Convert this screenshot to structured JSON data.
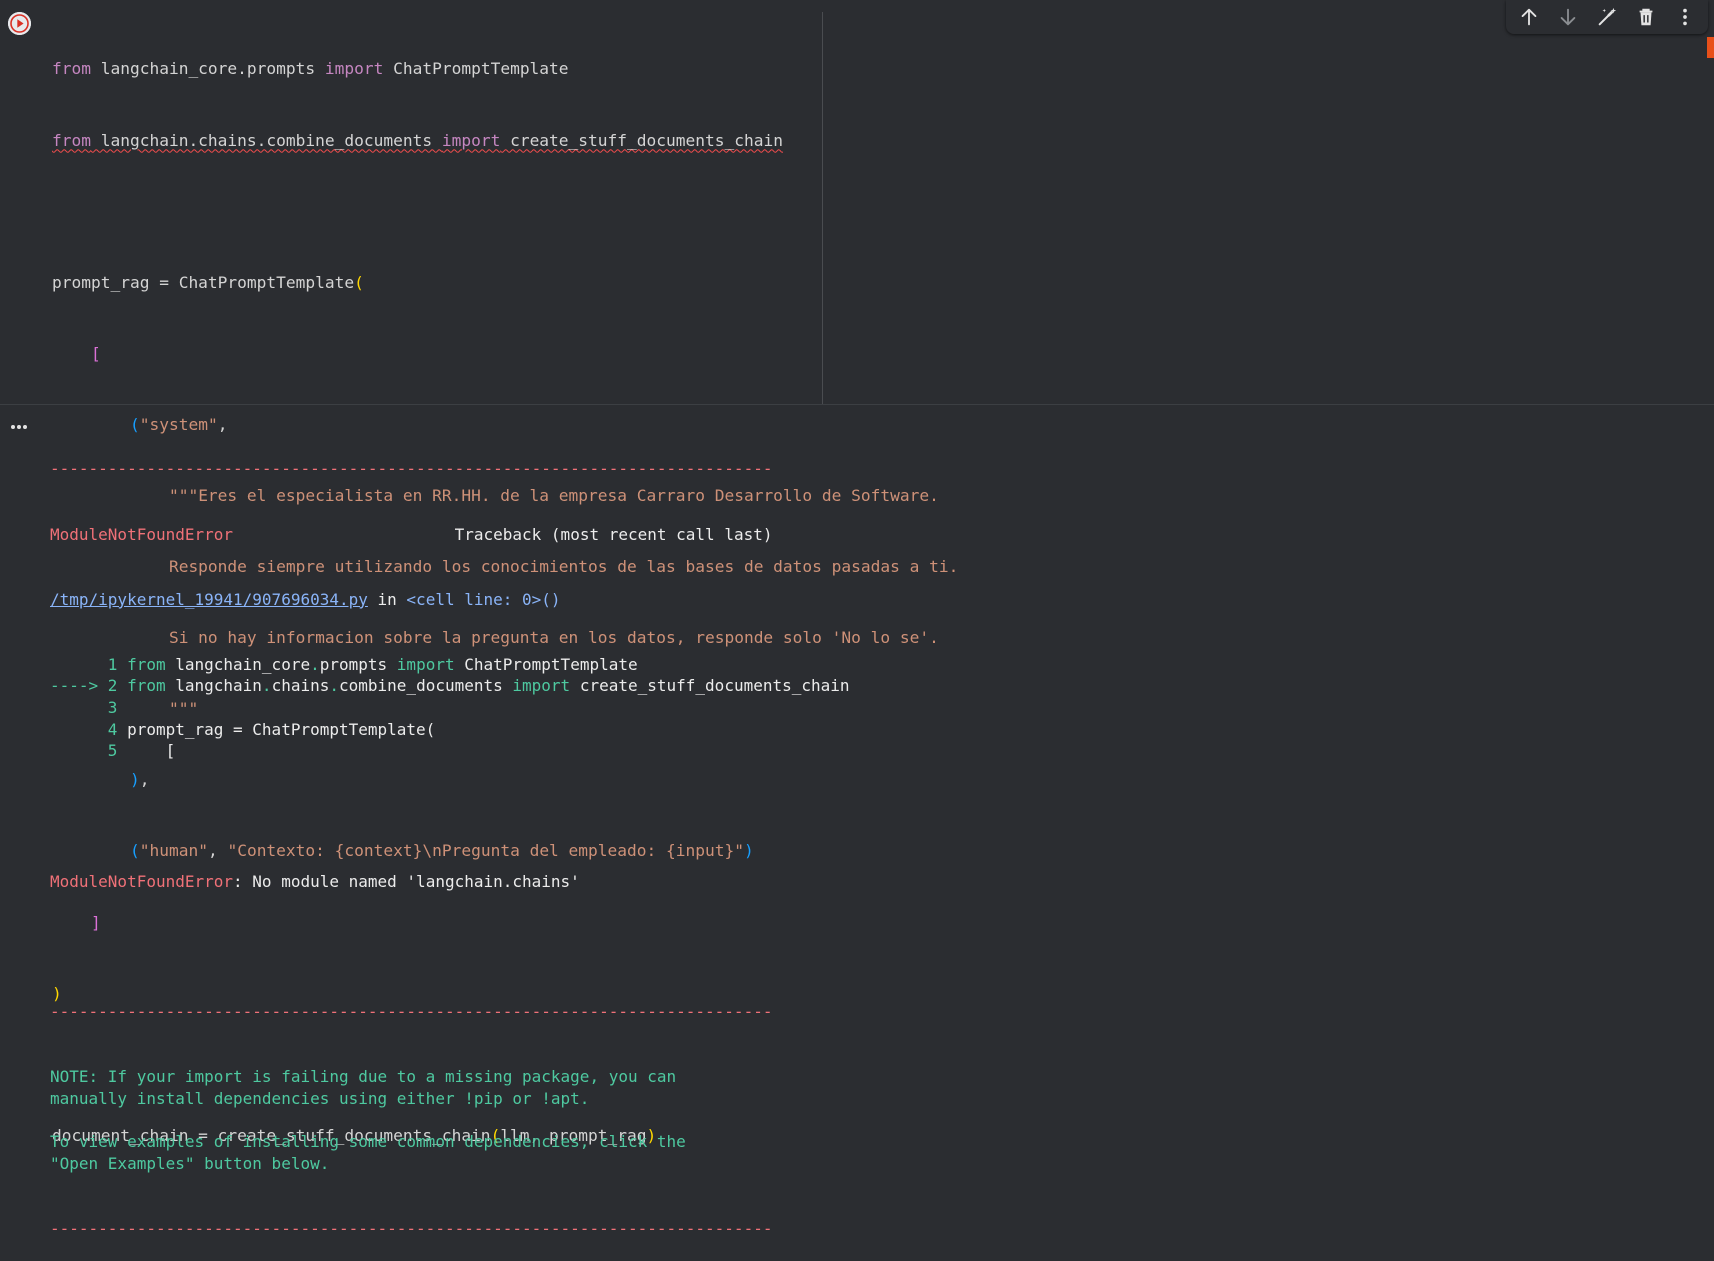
{
  "cell": {
    "code_lines": [
      "from langchain_core.prompts import ChatPromptTemplate",
      "from langchain.chains.combine_documents import create_stuff_documents_chain",
      "",
      "prompt_rag = ChatPromptTemplate(",
      "    [",
      "        (\"system\",",
      "            \"\"\"Eres el especialista en RR.HH. de la empresa Carraro Desarrollo de Software.",
      "            Responde siempre utilizando los conocimientos de las bases de datos pasadas a ti.",
      "            Si no hay informacion sobre la pregunta en los datos, responde solo 'No lo se'.",
      "            \"\"\"",
      "        ),",
      "        (\"human\", \"Contexto: {context}\\nPregunta del empleado: {input}\")",
      "    ]",
      ")",
      "",
      "document_chain = create_stuff_documents_chain(llm, prompt_rag)"
    ]
  },
  "toolbar": {
    "icons": [
      "arrow-up-icon",
      "arrow-down-icon",
      "magic-edit-icon",
      "trash-icon",
      "more-vert-icon"
    ]
  },
  "output": {
    "dash_line": "---------------------------------------------------------------------------",
    "error_name": "ModuleNotFoundError",
    "traceback_header": "Traceback (most recent call last)",
    "file_link": "/tmp/ipykernel_19941/907696034.py",
    "in_text": " in ",
    "cell_ref": "<cell line: 0>()",
    "tb_lines": [
      {
        "gutter": "      1 ",
        "text": "from langchain_core.prompts import ChatPromptTemplate"
      },
      {
        "gutter": "----> 2 ",
        "text": "from langchain.chains.combine_documents import create_stuff_documents_chain"
      },
      {
        "gutter": "      3 ",
        "text": ""
      },
      {
        "gutter": "      4 ",
        "text": "prompt_rag = ChatPromptTemplate("
      },
      {
        "gutter": "      5 ",
        "text": "    ["
      }
    ],
    "error_message": ": No module named 'langchain.chains'",
    "note_lines": [
      "NOTE: If your import is failing due to a missing package, you can",
      "manually install dependencies using either !pip or !apt.",
      "",
      "To view examples of installing some common dependencies, click the",
      "\"Open Examples\" button below."
    ]
  },
  "colors": {
    "background": "#2b2d31",
    "error_red": "#f07178",
    "note_green": "#4ec9a0",
    "link_blue": "#8ab4f8",
    "keyword": "#c586c0",
    "string": "#ce9178"
  }
}
